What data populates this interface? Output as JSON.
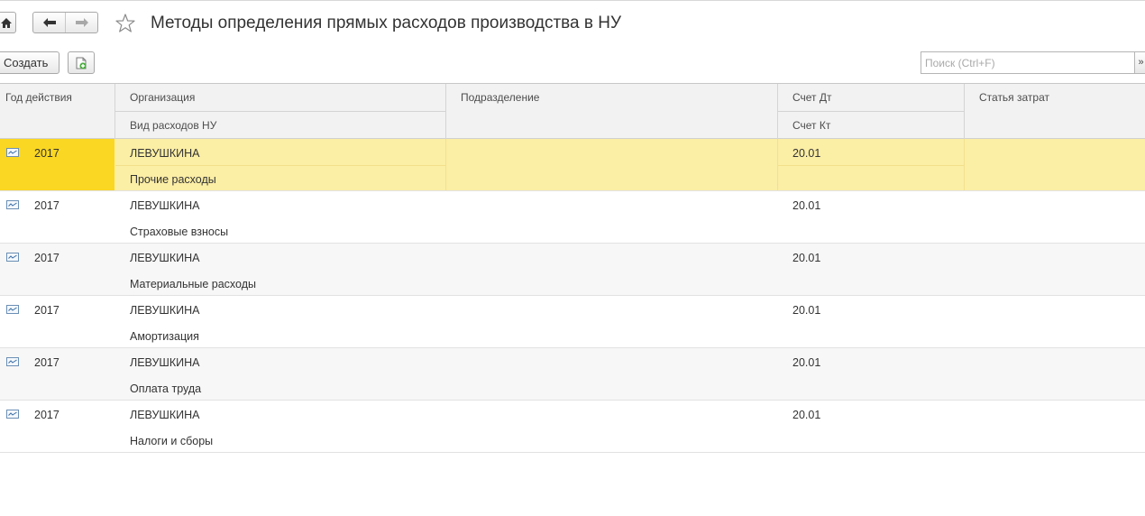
{
  "window": {
    "title": "Методы определения прямых расходов производства в НУ"
  },
  "toolbar": {
    "create_label": "Создать",
    "search_placeholder": "Поиск (Ctrl+F)",
    "more_label": "»"
  },
  "table": {
    "headers": {
      "year": "Год действия",
      "organization": "Организация",
      "expense_type": "Вид расходов НУ",
      "division": "Подразделение",
      "account_dt": "Счет Дт",
      "account_kt": "Счет Кт",
      "cost_item": "Статья затрат"
    },
    "rows": [
      {
        "year": "2017",
        "organization": "ЛЕВУШКИНА",
        "expense_type": "Прочие расходы",
        "division": "",
        "account_dt": "20.01",
        "account_kt": "",
        "cost_item": ""
      },
      {
        "year": "2017",
        "organization": "ЛЕВУШКИНА",
        "expense_type": "Страховые взносы",
        "division": "",
        "account_dt": "20.01",
        "account_kt": "",
        "cost_item": ""
      },
      {
        "year": "2017",
        "organization": "ЛЕВУШКИНА",
        "expense_type": "Материальные расходы",
        "division": "",
        "account_dt": "20.01",
        "account_kt": "",
        "cost_item": ""
      },
      {
        "year": "2017",
        "organization": "ЛЕВУШКИНА",
        "expense_type": "Амортизация",
        "division": "",
        "account_dt": "20.01",
        "account_kt": "",
        "cost_item": ""
      },
      {
        "year": "2017",
        "organization": "ЛЕВУШКИНА",
        "expense_type": "Оплата труда",
        "division": "",
        "account_dt": "20.01",
        "account_kt": "",
        "cost_item": ""
      },
      {
        "year": "2017",
        "organization": "ЛЕВУШКИНА",
        "expense_type": "Налоги и сборы",
        "division": "",
        "account_dt": "20.01",
        "account_kt": "",
        "cost_item": ""
      }
    ],
    "selected_row": 0
  },
  "icons": {
    "home": "home-icon",
    "back": "arrow-left-icon",
    "forward": "arrow-right-icon",
    "favorite": "star-icon",
    "copy": "copy-document-icon",
    "row": "record-icon"
  },
  "colors": {
    "selected_row": "#fbeea5",
    "selected_cell": "#fad722",
    "header_bg": "#f2f2f2"
  }
}
